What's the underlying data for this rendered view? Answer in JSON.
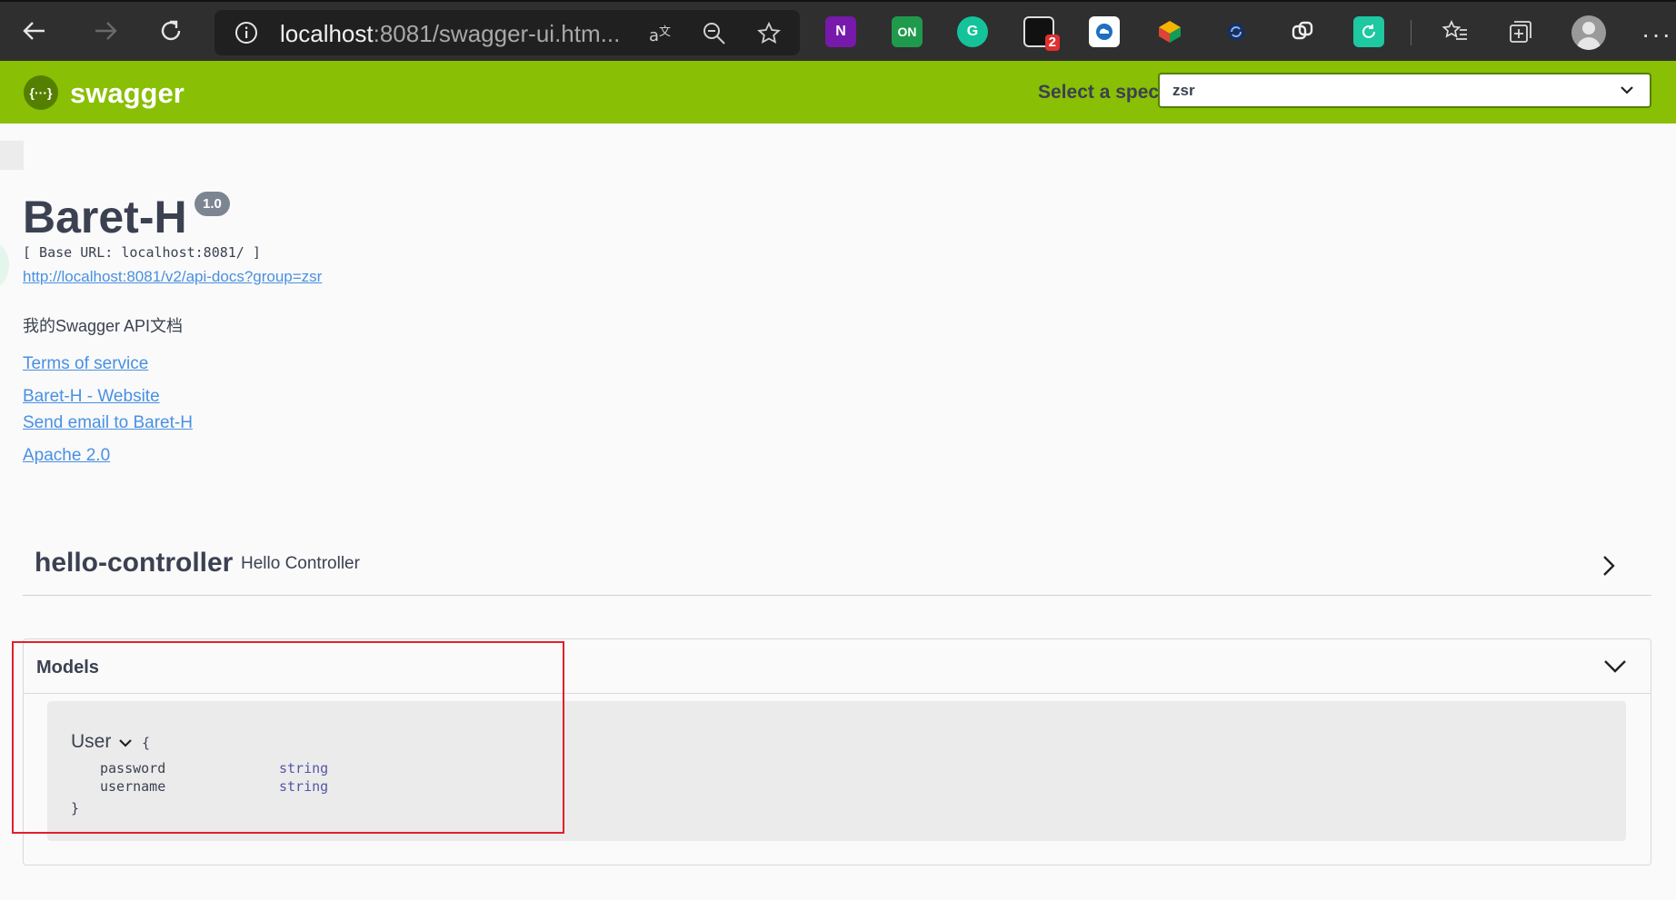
{
  "browser": {
    "url_host": "localhost",
    "url_rest": ":8081/swagger-ui.htm...",
    "extensions": [
      {
        "name": "onenote",
        "label": "N",
        "color": "#7719aa"
      },
      {
        "name": "on-toggle",
        "label": "ON",
        "color": "#1f9a4c"
      },
      {
        "name": "grammarly",
        "label": "G",
        "color": "#15c39a"
      },
      {
        "name": "ext-badge",
        "label": "",
        "color": "#111111",
        "badge": "2"
      },
      {
        "name": "cloud",
        "label": "",
        "color": "#ffffff"
      },
      {
        "name": "colorful",
        "label": "",
        "color": "#2f2f2f"
      },
      {
        "name": "sync",
        "label": "",
        "color": "#2f2f2f"
      },
      {
        "name": "link",
        "label": "",
        "color": "#2f2f2f"
      },
      {
        "name": "refresh-green",
        "label": "",
        "color": "#1ec8a0"
      }
    ]
  },
  "topbar": {
    "logo_glyph": "{···}",
    "logo_text": "swagger",
    "spec_label": "Select a spec",
    "spec_value": "zsr",
    "bg_color": "#89bf04"
  },
  "info": {
    "title": "Baret-H",
    "version": "1.0",
    "base_url": "[ Base URL: localhost:8081/ ]",
    "docs_link": "http://localhost:8081/v2/api-docs?group=zsr",
    "description": "我的Swagger API文档",
    "terms": "Terms of service",
    "website": "Baret-H - Website",
    "email": "Send email to Baret-H",
    "license": "Apache 2.0"
  },
  "controller": {
    "name": "hello-controller",
    "description": "Hello Controller"
  },
  "models": {
    "title": "Models",
    "model_name": "User",
    "brace_open": "{",
    "brace_close": "}",
    "properties": [
      {
        "name": "password",
        "type": "string"
      },
      {
        "name": "username",
        "type": "string"
      }
    ]
  }
}
